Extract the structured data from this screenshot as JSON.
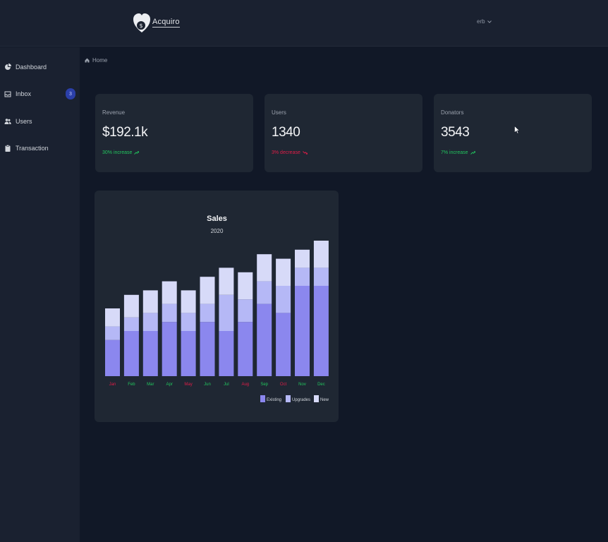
{
  "app": {
    "brand": "Acquiro",
    "user_menu_label": "erb"
  },
  "sidebar": {
    "items": [
      {
        "label": "Dashboard",
        "icon": "pie-chart-icon"
      },
      {
        "label": "Inbox",
        "icon": "inbox-icon",
        "badge": "3"
      },
      {
        "label": "Users",
        "icon": "users-icon"
      },
      {
        "label": "Transaction",
        "icon": "clipboard-icon"
      }
    ]
  },
  "breadcrumb": {
    "home": "Home"
  },
  "stats": [
    {
      "label": "Revenue",
      "value": "$192.1k",
      "trend": "30% increase",
      "direction": "up"
    },
    {
      "label": "Users",
      "value": "1340",
      "trend": "3% decrease",
      "direction": "down"
    },
    {
      "label": "Donators",
      "value": "3543",
      "trend": "7% increase",
      "direction": "up"
    }
  ],
  "colors": {
    "background": "#111827",
    "panel": "#1f2733",
    "existing": "#8b87ee",
    "upgrades": "#b5b8f6",
    "new": "#d7daf8",
    "increase": "#22c55e",
    "decrease": "#e11d48"
  },
  "chart_data": {
    "type": "bar",
    "stacked": true,
    "title": "Sales",
    "subtitle": "2020",
    "categories": [
      "Jan",
      "Feb",
      "Mar",
      "Apr",
      "May",
      "Jun",
      "Jul",
      "Aug",
      "Sep",
      "Oct",
      "Nov",
      "Dec"
    ],
    "category_label_colors": [
      "#e11d48",
      "#22c55e",
      "#22c55e",
      "#22c55e",
      "#e11d48",
      "#22c55e",
      "#22c55e",
      "#e11d48",
      "#22c55e",
      "#e11d48",
      "#22c55e",
      "#22c55e"
    ],
    "series": [
      {
        "name": "Existing",
        "values": [
          40,
          50,
          50,
          60,
          50,
          60,
          50,
          60,
          80,
          70,
          100,
          100
        ]
      },
      {
        "name": "Upgrades",
        "values": [
          15,
          15,
          20,
          20,
          20,
          20,
          40,
          25,
          25,
          30,
          20,
          20
        ]
      },
      {
        "name": "New",
        "values": [
          20,
          25,
          25,
          25,
          25,
          30,
          30,
          30,
          30,
          30,
          20,
          30
        ]
      }
    ],
    "ylim": [
      0,
      150
    ],
    "grid": false,
    "legend": "bottom-right"
  }
}
